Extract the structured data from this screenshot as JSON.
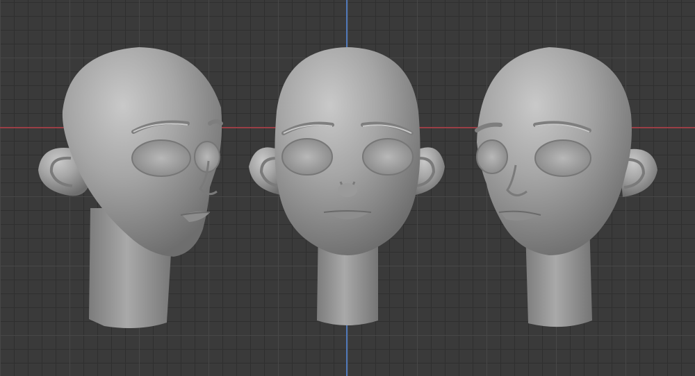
{
  "viewport": {
    "background_color": "#3a3a3a",
    "grid_minor_color": "#2f2f2f",
    "grid_major_color": "#474747",
    "axis_x_color": "#9a3f46",
    "axis_y_color": "#4f78b8",
    "model_color": "#9c9c9c"
  },
  "objects": [
    {
      "name": "head-model-three-quarter-right"
    },
    {
      "name": "head-model-front"
    },
    {
      "name": "head-model-three-quarter-left"
    }
  ]
}
